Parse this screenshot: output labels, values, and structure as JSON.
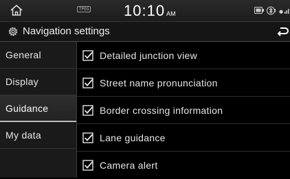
{
  "status_bar": {
    "home_icon": "home-icon",
    "tpeg_label": "TPEG",
    "time": "10:10",
    "ampm": "AM",
    "icons": [
      "media-icon",
      "bluetooth-audio-icon",
      "signal-icon"
    ]
  },
  "header": {
    "title": "Navigation settings",
    "title_icon": "gear-icon",
    "back_icon": "back-arrow-icon"
  },
  "sidebar": {
    "items": [
      {
        "label": "General",
        "active": false
      },
      {
        "label": "Display",
        "active": false
      },
      {
        "label": "Guidance",
        "active": true
      },
      {
        "label": "My data",
        "active": false
      }
    ]
  },
  "settings": {
    "items": [
      {
        "label": "Detailed junction view",
        "checked": true
      },
      {
        "label": "Street name pronunciation",
        "checked": true
      },
      {
        "label": "Border crossing information",
        "checked": true
      },
      {
        "label": "Lane guidance",
        "checked": true
      },
      {
        "label": "Camera alert",
        "checked": true
      }
    ]
  },
  "colors": {
    "background": "#000000",
    "text": "#e6e6e6",
    "divider": "#2e2e2e",
    "sidebar_bg": "#1a1a1a"
  }
}
